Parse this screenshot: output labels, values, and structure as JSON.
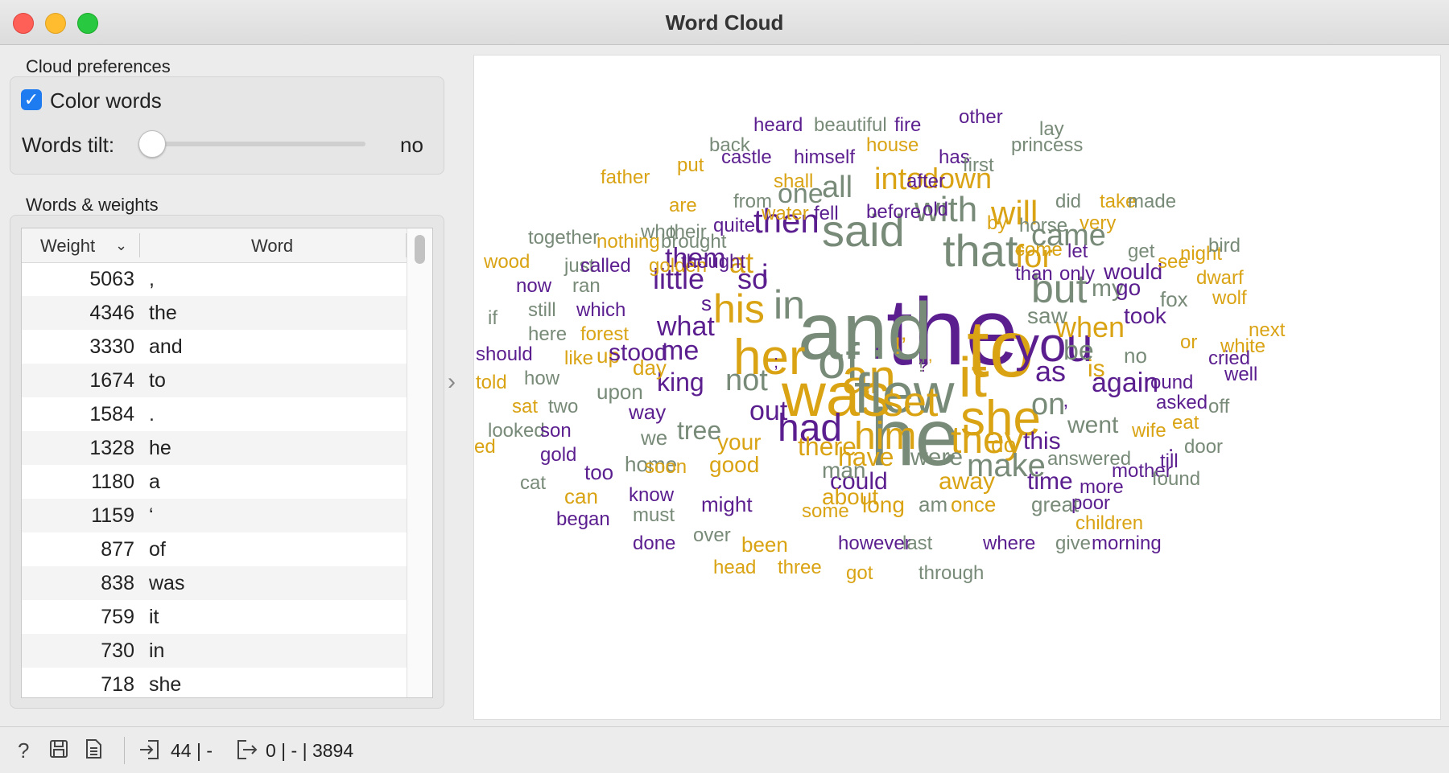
{
  "window": {
    "title": "Word Cloud"
  },
  "preferences": {
    "section_label": "Cloud preferences",
    "color_words_label": "Color words",
    "color_words_checked": true,
    "checkmark": "✓",
    "tilt_label": "Words tilt:",
    "tilt_value": "no",
    "tilt_level": 0
  },
  "words_table": {
    "section_label": "Words & weights",
    "col_weight": "Weight",
    "col_word": "Word",
    "rows": [
      {
        "weight": "5063",
        "word": ","
      },
      {
        "weight": "4346",
        "word": "the"
      },
      {
        "weight": "3330",
        "word": "and"
      },
      {
        "weight": "1674",
        "word": "to"
      },
      {
        "weight": "1584",
        "word": "."
      },
      {
        "weight": "1328",
        "word": "he"
      },
      {
        "weight": "1180",
        "word": "a"
      },
      {
        "weight": "1159",
        "word": "‘"
      },
      {
        "weight": "877",
        "word": "of"
      },
      {
        "weight": "838",
        "word": "was"
      },
      {
        "weight": "759",
        "word": "it"
      },
      {
        "weight": "730",
        "word": "in"
      },
      {
        "weight": "718",
        "word": "she"
      }
    ]
  },
  "cloud": {
    "colors": {
      "purple": "#5b1e8f",
      "gold": "#d9a314",
      "gray": "#788a78"
    },
    "words": [
      {
        "t": "the",
        "c": "purple"
      },
      {
        "t": "and",
        "c": "gray"
      },
      {
        "t": "to",
        "c": "gold"
      },
      {
        "t": "he",
        "c": "gray"
      },
      {
        "t": "was",
        "c": "gold"
      },
      {
        "t": "it",
        "c": "gold"
      },
      {
        "t": "she",
        "c": "gold"
      },
      {
        "t": "her",
        "c": "gold"
      },
      {
        "t": "of",
        "c": "gray"
      },
      {
        "t": "you",
        "c": "purple"
      },
      {
        "t": "that",
        "c": "gray"
      },
      {
        "t": "said",
        "c": "gray"
      },
      {
        "t": "his",
        "c": "gold"
      },
      {
        "t": "in",
        "c": "gray"
      },
      {
        "t": "but",
        "c": "gray"
      },
      {
        "t": "had",
        "c": "purple"
      },
      {
        "t": "him",
        "c": "gold"
      },
      {
        "t": "they",
        "c": "gold"
      },
      {
        "t": "with",
        "c": "gray"
      },
      {
        "t": "then",
        "c": "purple"
      },
      {
        "t": "will",
        "c": "gold"
      },
      {
        "t": "for",
        "c": "gold"
      },
      {
        "t": "came",
        "c": "gray"
      },
      {
        "t": "not",
        "c": "gray"
      },
      {
        "t": "so",
        "c": "purple"
      },
      {
        "t": "as",
        "c": "purple"
      },
      {
        "t": "when",
        "c": "gold"
      },
      {
        "t": "on",
        "c": "gray"
      },
      {
        "t": "at",
        "c": "gold"
      },
      {
        "t": "i",
        "c": "purple"
      },
      {
        "t": "all",
        "c": "gray"
      },
      {
        "t": "into",
        "c": "gold"
      },
      {
        "t": "down",
        "c": "gold"
      },
      {
        "t": "one",
        "c": "gray"
      },
      {
        "t": "little",
        "c": "purple"
      },
      {
        "t": "them",
        "c": "purple"
      },
      {
        "t": "what",
        "c": "purple"
      },
      {
        "t": "me",
        "c": "purple"
      },
      {
        "t": "be",
        "c": "gray"
      },
      {
        "t": "again",
        "c": "purple"
      },
      {
        "t": "is",
        "c": "gold"
      },
      {
        "t": "out",
        "c": "purple"
      },
      {
        "t": "king",
        "c": "purple"
      },
      {
        "t": "there",
        "c": "gold"
      },
      {
        "t": "have",
        "c": "gold"
      },
      {
        "t": "were",
        "c": "gray"
      },
      {
        "t": "went",
        "c": "gray"
      },
      {
        "t": "this",
        "c": "purple"
      },
      {
        "t": "could",
        "c": "purple"
      },
      {
        "t": "away",
        "c": "gold"
      },
      {
        "t": "time",
        "c": "purple"
      },
      {
        "t": "do",
        "c": "gold"
      },
      {
        "t": "your",
        "c": "gold"
      },
      {
        "t": "good",
        "c": "gold"
      },
      {
        "t": "man",
        "c": "gray"
      },
      {
        "t": "about",
        "c": "gold"
      },
      {
        "t": "long",
        "c": "gold"
      },
      {
        "t": "am",
        "c": "gray"
      },
      {
        "t": "once",
        "c": "gold"
      },
      {
        "t": "great",
        "c": "gray"
      },
      {
        "t": "my",
        "c": "gray"
      },
      {
        "t": "would",
        "c": "purple"
      },
      {
        "t": "took",
        "c": "purple"
      },
      {
        "t": "go",
        "c": "purple"
      },
      {
        "t": "fox",
        "c": "gray"
      },
      {
        "t": "no",
        "c": "gray"
      },
      {
        "t": "saw",
        "c": "gray"
      },
      {
        "t": "s",
        "c": "purple"
      },
      {
        "t": "up",
        "c": "gold"
      },
      {
        "t": "day",
        "c": "gold"
      },
      {
        "t": "upon",
        "c": "gray"
      },
      {
        "t": "way",
        "c": "purple"
      },
      {
        "t": "we",
        "c": "gray"
      },
      {
        "t": "home",
        "c": "gray"
      },
      {
        "t": "too",
        "c": "purple"
      },
      {
        "t": "soon",
        "c": "gold"
      },
      {
        "t": "can",
        "c": "gold"
      },
      {
        "t": "know",
        "c": "purple"
      },
      {
        "t": "began",
        "c": "purple"
      },
      {
        "t": "must",
        "c": "gray"
      },
      {
        "t": "might",
        "c": "purple"
      },
      {
        "t": "done",
        "c": "purple"
      },
      {
        "t": "some",
        "c": "gold"
      },
      {
        "t": "over",
        "c": "gray"
      },
      {
        "t": "been",
        "c": "gold"
      },
      {
        "t": "however",
        "c": "purple"
      },
      {
        "t": "last",
        "c": "gray"
      },
      {
        "t": "where",
        "c": "purple"
      },
      {
        "t": "give",
        "c": "gray"
      },
      {
        "t": "head",
        "c": "gold"
      },
      {
        "t": "three",
        "c": "gold"
      },
      {
        "t": "got",
        "c": "gold"
      },
      {
        "t": "through",
        "c": "gray"
      },
      {
        "t": "children",
        "c": "gold"
      },
      {
        "t": "morning",
        "c": "purple"
      },
      {
        "t": "poor",
        "c": "purple"
      },
      {
        "t": "more",
        "c": "purple"
      },
      {
        "t": "mother",
        "c": "purple"
      },
      {
        "t": "found",
        "c": "gray"
      },
      {
        "t": "till",
        "c": "purple"
      },
      {
        "t": "answered",
        "c": "gray"
      },
      {
        "t": "wife",
        "c": "gold"
      },
      {
        "t": "door",
        "c": "gray"
      },
      {
        "t": "eat",
        "c": "gold"
      },
      {
        "t": "off",
        "c": "gray"
      },
      {
        "t": "well",
        "c": "purple"
      },
      {
        "t": "white",
        "c": "gold"
      },
      {
        "t": "next",
        "c": "gold"
      },
      {
        "t": "cried",
        "c": "purple"
      },
      {
        "t": "round",
        "c": "purple"
      },
      {
        "t": "asked",
        "c": "purple"
      },
      {
        "t": "or",
        "c": "gold"
      },
      {
        "t": "wolf",
        "c": "gold"
      },
      {
        "t": "dwarf",
        "c": "gold"
      },
      {
        "t": "see",
        "c": "gold"
      },
      {
        "t": "night",
        "c": "gold"
      },
      {
        "t": "bird",
        "c": "gray"
      },
      {
        "t": "than",
        "c": "purple"
      },
      {
        "t": "only",
        "c": "purple"
      },
      {
        "t": "come",
        "c": "gold"
      },
      {
        "t": "let",
        "c": "purple"
      },
      {
        "t": "get",
        "c": "gray"
      },
      {
        "t": "horse",
        "c": "gray"
      },
      {
        "t": "by",
        "c": "gold"
      },
      {
        "t": "very",
        "c": "gold"
      },
      {
        "t": "did",
        "c": "gray"
      },
      {
        "t": "take",
        "c": "gold"
      },
      {
        "t": "made",
        "c": "gray"
      },
      {
        "t": "old",
        "c": "purple"
      },
      {
        "t": "before",
        "c": "purple"
      },
      {
        "t": "fell",
        "c": "purple"
      },
      {
        "t": "water",
        "c": "gold"
      },
      {
        "t": "quite",
        "c": "purple"
      },
      {
        "t": "from",
        "c": "gray"
      },
      {
        "t": "are",
        "c": "gold"
      },
      {
        "t": "their",
        "c": "gray"
      },
      {
        "t": "who",
        "c": "gray"
      },
      {
        "t": "father",
        "c": "gold"
      },
      {
        "t": "shall",
        "c": "gold"
      },
      {
        "t": "after",
        "c": "purple"
      },
      {
        "t": "has",
        "c": "purple"
      },
      {
        "t": "first",
        "c": "gray"
      },
      {
        "t": "put",
        "c": "gold"
      },
      {
        "t": "castle",
        "c": "purple"
      },
      {
        "t": "himself",
        "c": "purple"
      },
      {
        "t": "back",
        "c": "gray"
      },
      {
        "t": "house",
        "c": "gold"
      },
      {
        "t": "princess",
        "c": "gray"
      },
      {
        "t": "lay",
        "c": "gray"
      },
      {
        "t": "heard",
        "c": "purple"
      },
      {
        "t": "beautiful",
        "c": "gray"
      },
      {
        "t": "fire",
        "c": "purple"
      },
      {
        "t": "other",
        "c": "purple"
      },
      {
        "t": "nothing",
        "c": "gold"
      },
      {
        "t": "brought",
        "c": "gray"
      },
      {
        "t": "together",
        "c": "gray"
      },
      {
        "t": "just",
        "c": "gray"
      },
      {
        "t": "called",
        "c": "purple"
      },
      {
        "t": "golden",
        "c": "gold"
      },
      {
        "t": "thought",
        "c": "purple"
      },
      {
        "t": "now",
        "c": "purple"
      },
      {
        "t": "wood",
        "c": "gold"
      },
      {
        "t": "ran",
        "c": "gray"
      },
      {
        "t": "still",
        "c": "gray"
      },
      {
        "t": "which",
        "c": "purple"
      },
      {
        "t": "if",
        "c": "gray"
      },
      {
        "t": "here",
        "c": "gray"
      },
      {
        "t": "forest",
        "c": "gold"
      },
      {
        "t": "should",
        "c": "purple"
      },
      {
        "t": "like",
        "c": "gold"
      },
      {
        "t": "how",
        "c": "gray"
      },
      {
        "t": "told",
        "c": "gold"
      },
      {
        "t": "sat",
        "c": "gold"
      },
      {
        "t": "two",
        "c": "gray"
      },
      {
        "t": "looked",
        "c": "gray"
      },
      {
        "t": "son",
        "c": "purple"
      },
      {
        "t": "red",
        "c": "gold"
      },
      {
        "t": "gold",
        "c": "purple"
      },
      {
        "t": "cat",
        "c": "gray"
      },
      {
        "t": "an",
        "c": "gold"
      },
      {
        "t": "flew",
        "c": "gray"
      },
      {
        "t": "set",
        "c": "gold"
      },
      {
        "t": "make",
        "c": "gray"
      },
      {
        "t": "tree",
        "c": "gray"
      },
      {
        "t": "stood",
        "c": "purple"
      },
      {
        "t": "’",
        "c": "purple"
      },
      {
        "t": ".",
        "c": "purple"
      },
      {
        "t": ";",
        "c": "purple"
      },
      {
        "t": ":",
        "c": "purple"
      },
      {
        "t": "!’",
        "c": "gold"
      },
      {
        "t": "?’",
        "c": "gold"
      },
      {
        "t": "!",
        "c": "gray"
      },
      {
        "t": "?",
        "c": "purple"
      },
      {
        "t": "\"",
        "c": "gray"
      },
      {
        "t": "’",
        "c": "gold"
      },
      {
        "t": "’",
        "c": "purple"
      }
    ]
  },
  "statusbar": {
    "input_summary": "44 | -",
    "output_summary": "0 | - | 3894"
  }
}
